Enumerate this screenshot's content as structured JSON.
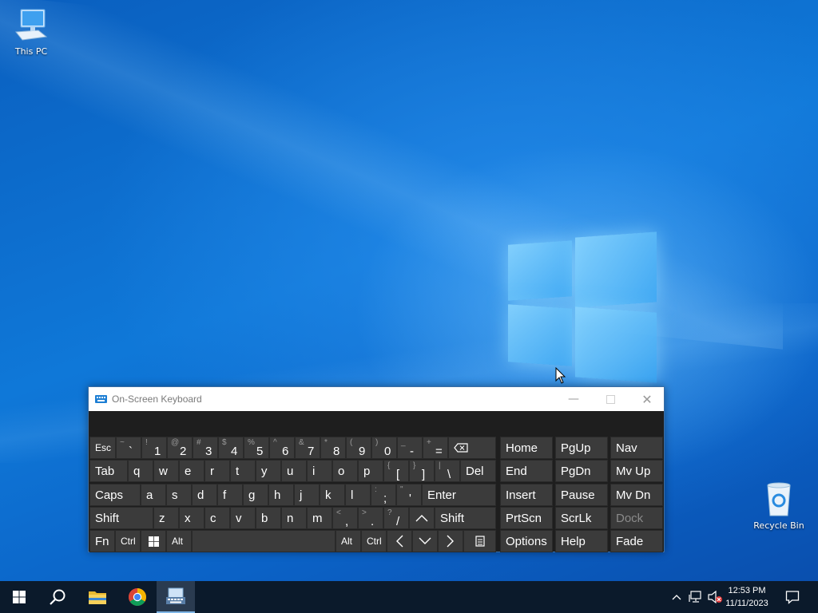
{
  "desktop": {
    "icons": [
      {
        "label": "This PC"
      },
      {
        "label": "Recycle Bin"
      }
    ]
  },
  "osk": {
    "title": "On-Screen Keyboard",
    "rows": [
      [
        {
          "main": "Esc",
          "w": 32
        },
        {
          "shift": "~",
          "main": "`"
        },
        {
          "shift": "!",
          "main": "1"
        },
        {
          "shift": "@",
          "main": "2"
        },
        {
          "shift": "#",
          "main": "3"
        },
        {
          "shift": "$",
          "main": "4"
        },
        {
          "shift": "%",
          "main": "5"
        },
        {
          "shift": "^",
          "main": "6"
        },
        {
          "shift": "&",
          "main": "7"
        },
        {
          "shift": "*",
          "main": "8"
        },
        {
          "shift": "(",
          "main": "9"
        },
        {
          "shift": ")",
          "main": "0"
        },
        {
          "shift": "_",
          "main": "-"
        },
        {
          "shift": "+",
          "main": "="
        },
        {
          "main": "⌫",
          "name": "backspace-key"
        }
      ],
      [
        {
          "main": "Tab"
        },
        {
          "main": "q"
        },
        {
          "main": "w"
        },
        {
          "main": "e"
        },
        {
          "main": "r"
        },
        {
          "main": "t"
        },
        {
          "main": "y"
        },
        {
          "main": "u"
        },
        {
          "main": "i"
        },
        {
          "main": "o"
        },
        {
          "main": "p"
        },
        {
          "shift": "{",
          "main": "["
        },
        {
          "shift": "}",
          "main": "]"
        },
        {
          "shift": "|",
          "main": "\\"
        },
        {
          "main": "Del"
        }
      ],
      [
        {
          "main": "Caps"
        },
        {
          "main": "a"
        },
        {
          "main": "s"
        },
        {
          "main": "d"
        },
        {
          "main": "f"
        },
        {
          "main": "g"
        },
        {
          "main": "h"
        },
        {
          "main": "j"
        },
        {
          "main": "k"
        },
        {
          "main": "l"
        },
        {
          "shift": ":",
          "main": ";"
        },
        {
          "shift": "\"",
          "main": "'"
        },
        {
          "main": "Enter"
        }
      ],
      [
        {
          "main": "Shift"
        },
        {
          "main": "z"
        },
        {
          "main": "x"
        },
        {
          "main": "c"
        },
        {
          "main": "v"
        },
        {
          "main": "b"
        },
        {
          "main": "n"
        },
        {
          "main": "m"
        },
        {
          "shift": "<",
          "main": ","
        },
        {
          "shift": ">",
          "main": "."
        },
        {
          "shift": "?",
          "main": "/"
        },
        {
          "main": "^",
          "name": "up-arrow-key"
        },
        {
          "main": "Shift"
        }
      ],
      [
        {
          "main": "Fn"
        },
        {
          "main": "Ctrl"
        },
        {
          "main": "",
          "name": "windows-key"
        },
        {
          "main": "Alt"
        },
        {
          "main": "",
          "name": "space-key"
        },
        {
          "main": "Alt"
        },
        {
          "main": "Ctrl"
        },
        {
          "main": "<",
          "name": "left-arrow-key"
        },
        {
          "main": "v",
          "name": "down-arrow-key"
        },
        {
          "main": ">",
          "name": "right-arrow-key"
        },
        {
          "main": "",
          "name": "context-menu-key"
        }
      ]
    ],
    "nav_keys": [
      [
        "Home",
        "PgUp",
        "Nav"
      ],
      [
        "End",
        "PgDn",
        "Mv Up"
      ],
      [
        "Insert",
        "Pause",
        "Mv Dn"
      ],
      [
        "PrtScn",
        "ScrLk",
        "Dock"
      ],
      [
        "Options",
        "Help",
        "Fade"
      ]
    ]
  },
  "taskbar": {
    "time": "12:53 PM",
    "date": "11/11/2023",
    "apps": [
      "start",
      "search",
      "file-explorer",
      "chrome",
      "on-screen-keyboard"
    ]
  }
}
